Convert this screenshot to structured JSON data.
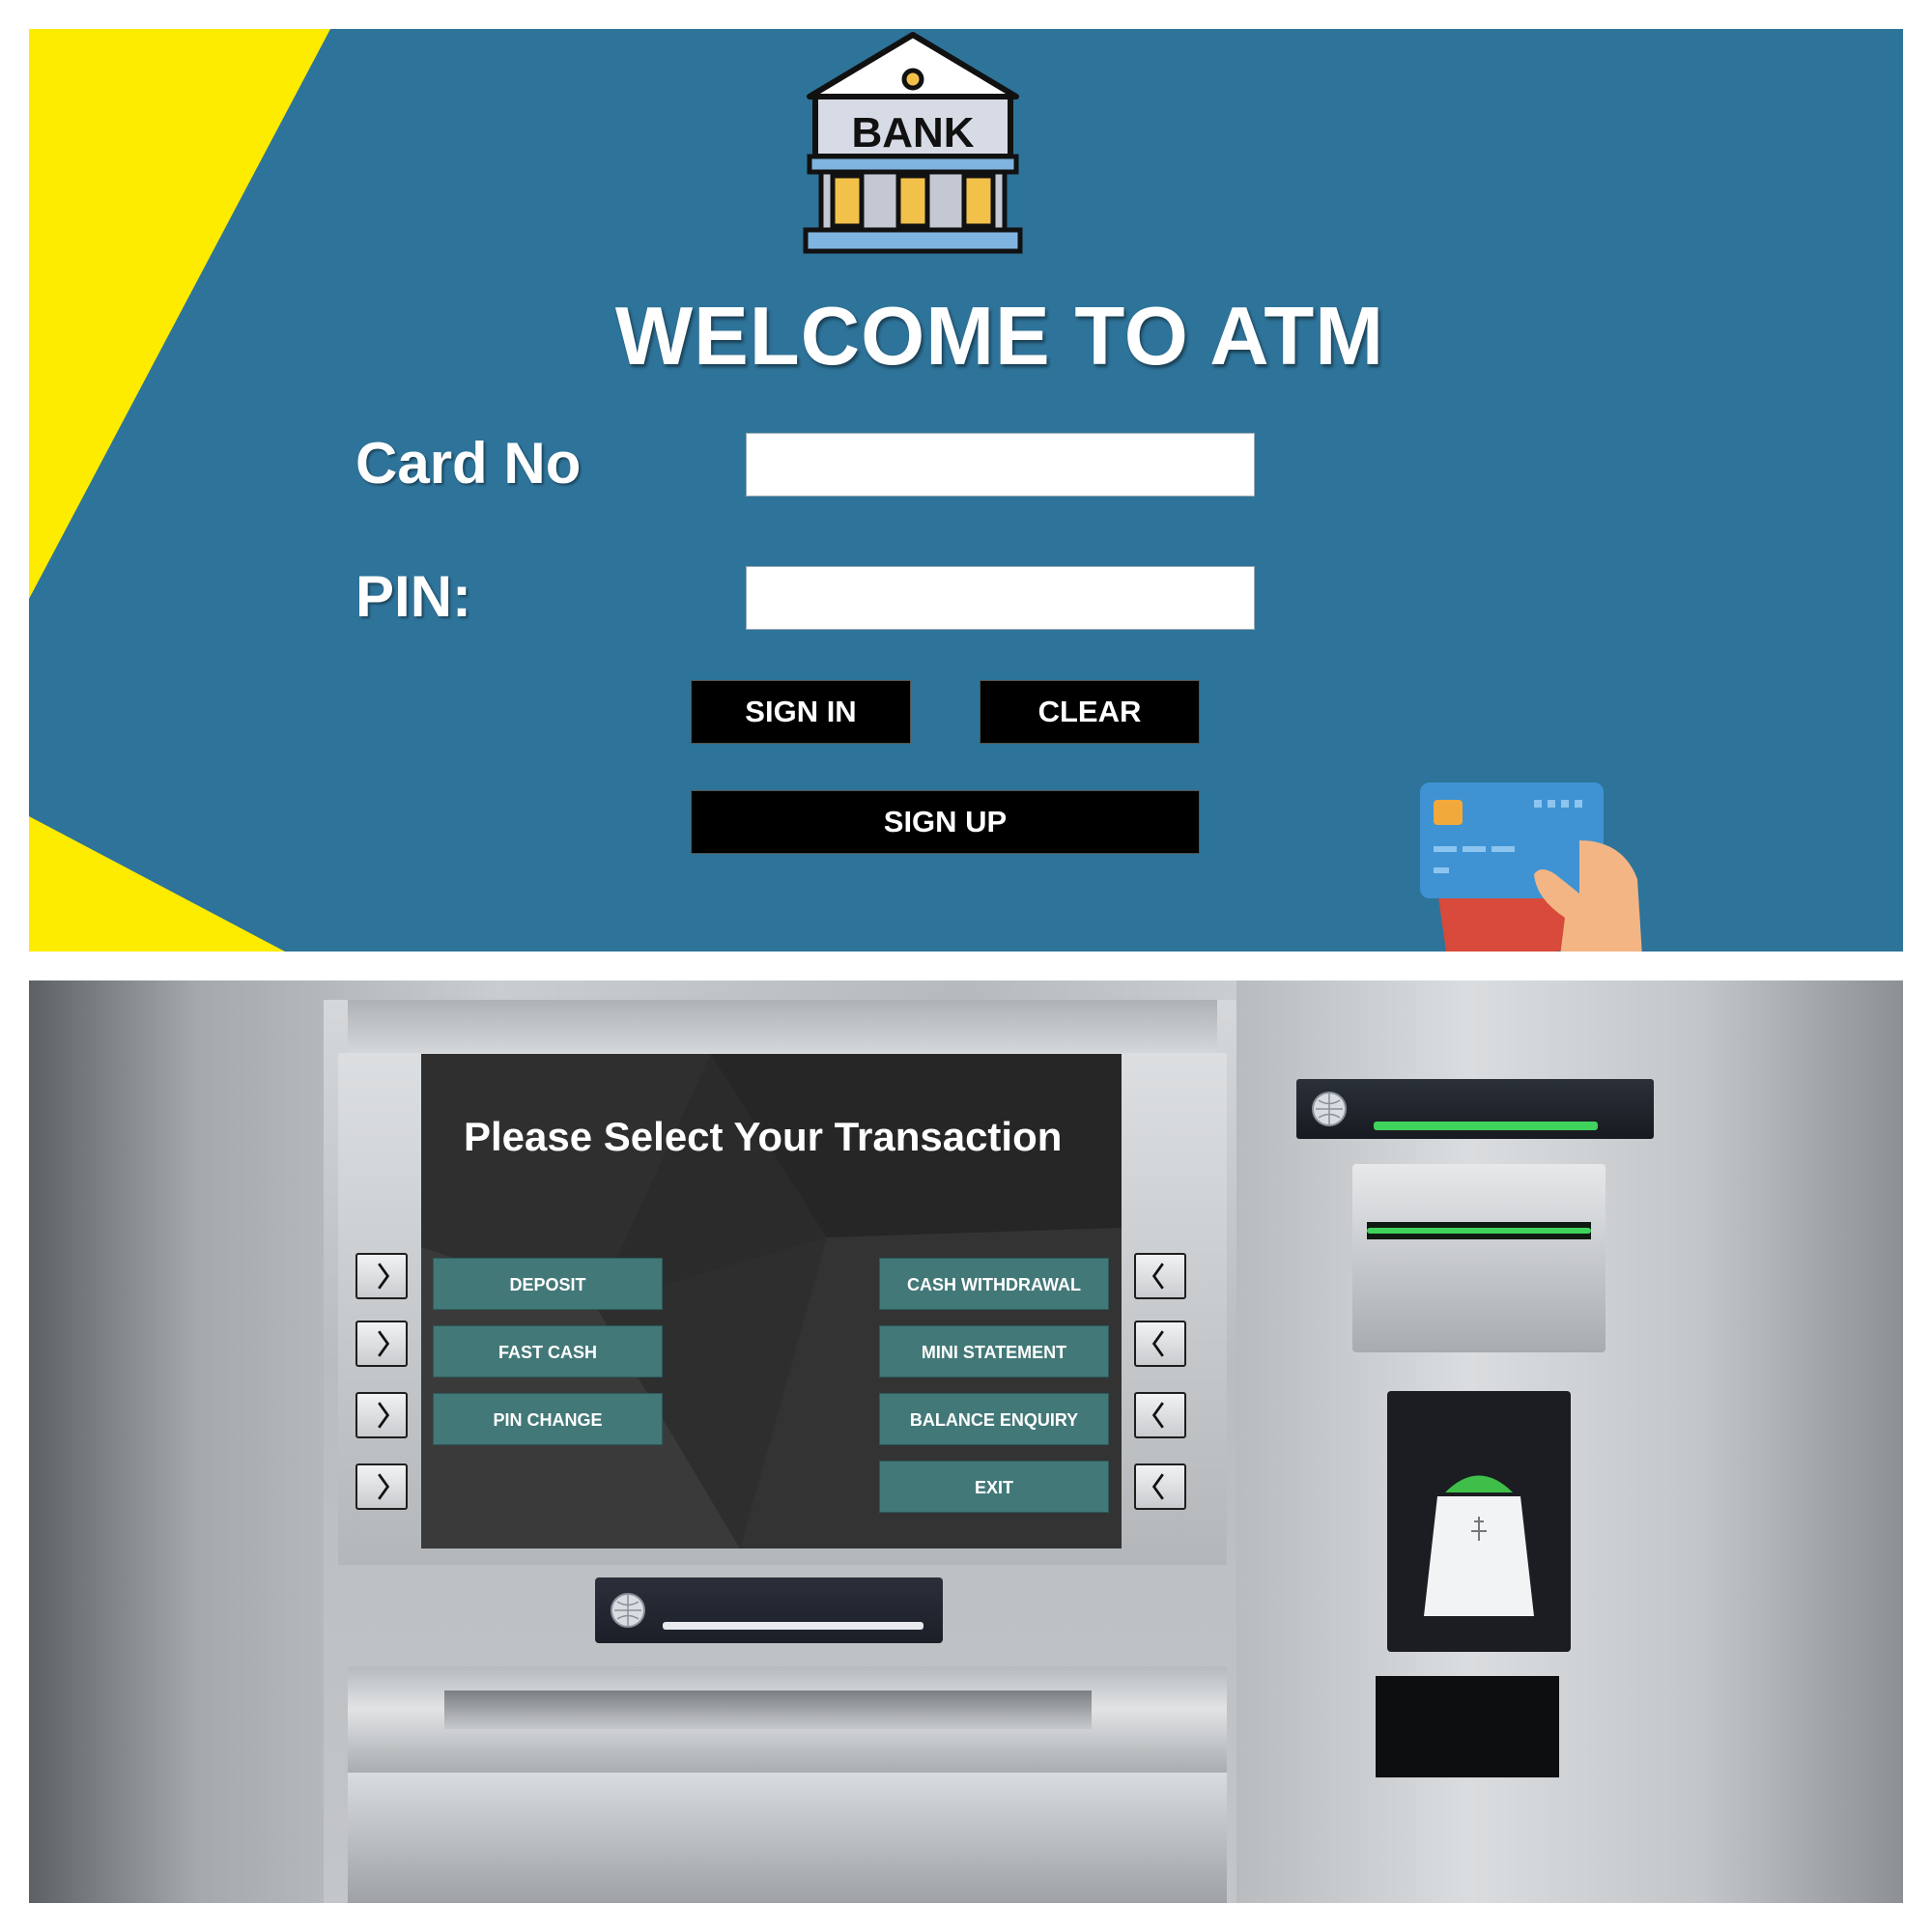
{
  "login": {
    "logo_text": "BANK",
    "title": "WELCOME TO ATM",
    "card_no_label": "Card No",
    "pin_label": "PIN:",
    "card_no_value": "",
    "pin_value": "",
    "sign_in_label": "SIGN IN",
    "clear_label": "CLEAR",
    "sign_up_label": "SIGN UP",
    "colors": {
      "background": "#2e7399",
      "accent": "#fdeb00",
      "button": "#000000"
    }
  },
  "transactions": {
    "title": "Please Select Your Transaction",
    "left_buttons": [
      {
        "label": "DEPOSIT"
      },
      {
        "label": "FAST CASH"
      },
      {
        "label": "PIN CHANGE"
      }
    ],
    "right_buttons": [
      {
        "label": "CASH WITHDRAWAL"
      },
      {
        "label": "MINI STATEMENT"
      },
      {
        "label": "BALANCE ENQUIRY"
      },
      {
        "label": "EXIT"
      }
    ],
    "colors": {
      "screen": "#2b2b2b",
      "button": "#437878"
    }
  }
}
